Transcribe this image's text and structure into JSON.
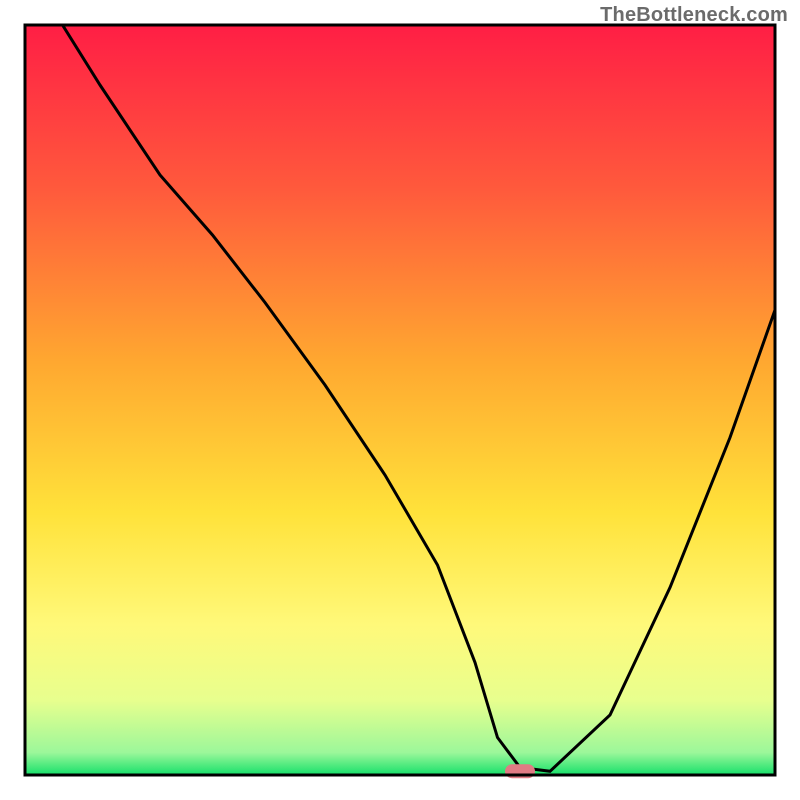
{
  "watermark": "TheBottleneck.com",
  "chart_data": {
    "type": "line",
    "title": "",
    "xlabel": "",
    "ylabel": "",
    "xlim": [
      0,
      100
    ],
    "ylim": [
      0,
      100
    ],
    "series": [
      {
        "name": "bottleneck-curve",
        "x": [
          5,
          10,
          18,
          25,
          32,
          40,
          48,
          55,
          60,
          63,
          66,
          70,
          78,
          86,
          94,
          100
        ],
        "y": [
          100,
          92,
          80,
          72,
          63,
          52,
          40,
          28,
          15,
          5,
          1,
          0.5,
          8,
          25,
          45,
          62
        ]
      }
    ],
    "marker": {
      "x": 66,
      "y": 0.5,
      "color": "#e07b84"
    },
    "gradient_stops": [
      {
        "offset": 0,
        "color": "#ff1e45"
      },
      {
        "offset": 22,
        "color": "#ff5a3c"
      },
      {
        "offset": 45,
        "color": "#ffa830"
      },
      {
        "offset": 65,
        "color": "#ffe23a"
      },
      {
        "offset": 80,
        "color": "#fff97a"
      },
      {
        "offset": 90,
        "color": "#e8ff8e"
      },
      {
        "offset": 97,
        "color": "#9cf79a"
      },
      {
        "offset": 100,
        "color": "#16e06a"
      }
    ],
    "frame_color": "#000000",
    "curve_color": "#000000"
  }
}
